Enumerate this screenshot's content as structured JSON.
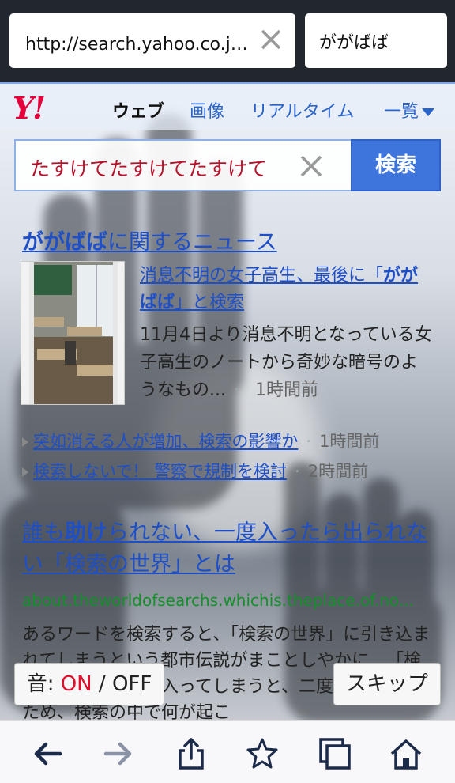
{
  "browser": {
    "url": "http://search.yahoo.co.jp/search?p=がガばば",
    "find_text": "ががばば"
  },
  "yahoo": {
    "logo": "Y!",
    "nav": [
      "ウェブ",
      "画像",
      "リアルタイム",
      "一覧"
    ],
    "search_value": "たすけてたすけてたすけて",
    "search_button": "検索"
  },
  "news": {
    "title_bold": "ががばば",
    "title_rest": "に関するニュース",
    "article": {
      "title_a": "消息不明の女子高生、最後に「",
      "title_bold": "ががばば",
      "title_b": "」と検索",
      "snippet": "11月4日より消息不明となっている女子高生のノートから奇妙な暗号のようなもの...",
      "time": "1時間前"
    },
    "subs": [
      {
        "text": "突如消える人が増加、検索の影響か",
        "time": "1時間前"
      },
      {
        "text": "検索しないで！ 警察で規制を検討",
        "time": "2時間前"
      }
    ]
  },
  "result": {
    "title_a": "誰も",
    "title_bold": "助け",
    "title_b": "られない、一度入ったら出られない「検索の世界」とは",
    "url": "about.theworldofsearchs.whichis.theplace.of.no...",
    "snippet": "あるワードを検索すると、「検索の世界」に引き込まれてしまうという都市伝説がまことしやかに…「検索の世界」に一度入ってしまうと、二度と戻れないため、検索の中で何が起こ"
  },
  "overlay": {
    "sound_label": "音:",
    "sound_on": "ON",
    "sound_sep": "/",
    "sound_off": "OFF",
    "skip": "スキップ"
  },
  "toolbar": [
    "back-icon",
    "forward-icon",
    "share-icon",
    "bookmark-icon",
    "tabs-icon",
    "home-icon"
  ],
  "colors": {
    "accent": "#3e75dc",
    "logo": "#e4003a",
    "link": "#1f4fc7",
    "url": "#14902a",
    "highlight": "#b5122c"
  }
}
